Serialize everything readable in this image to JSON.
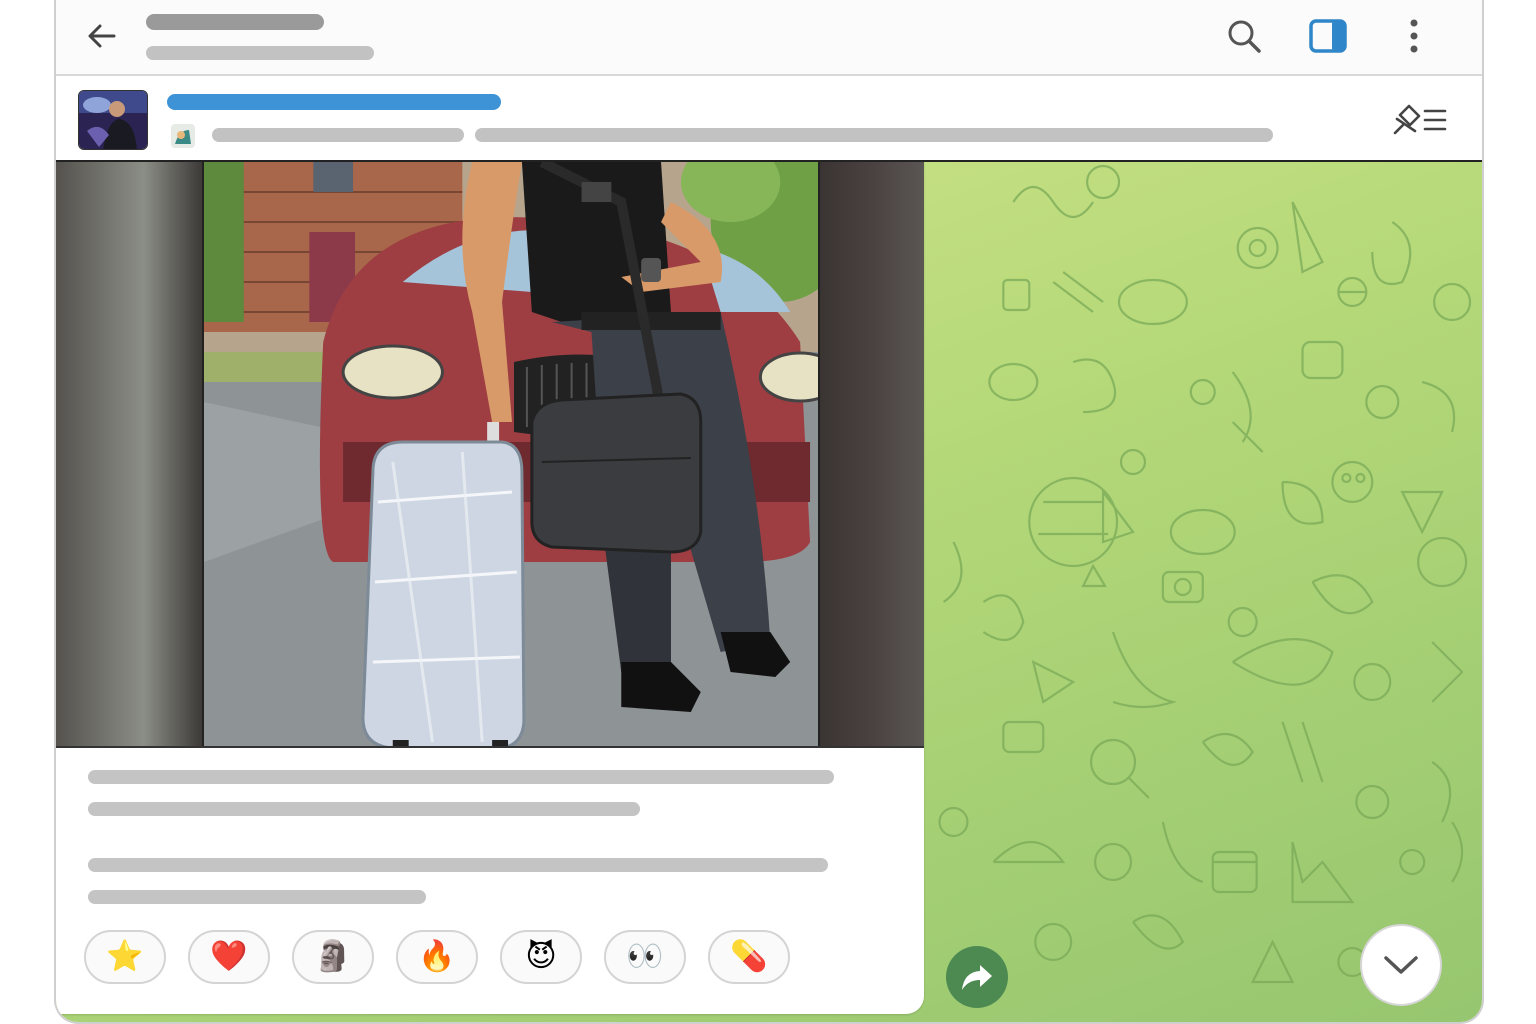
{
  "header": {
    "back_icon": "arrow-left-icon",
    "actions": [
      {
        "name": "search",
        "icon": "search-icon"
      },
      {
        "name": "sidebar-toggle",
        "icon": "sidebar-panel-icon",
        "accent": "#2f86c9"
      },
      {
        "name": "more-menu",
        "icon": "kebab-menu-icon"
      }
    ]
  },
  "pinned": {
    "title_color": "#3d93d6",
    "list_icon": "pin-list-icon"
  },
  "message": {
    "reactions": [
      {
        "emoji": "⭐",
        "icon": "star-reaction"
      },
      {
        "emoji": "❤️",
        "icon": "heart-reaction"
      },
      {
        "emoji": "🗿",
        "icon": "moai-reaction"
      },
      {
        "emoji": "🔥",
        "icon": "fire-reaction"
      },
      {
        "emoji": "😈",
        "icon": "devil-reaction"
      },
      {
        "emoji": "👀",
        "icon": "eyes-reaction"
      },
      {
        "emoji": "💊",
        "icon": "pill-reaction"
      }
    ]
  },
  "chat": {
    "background_color": "#b4d878",
    "share_icon": "share-arrow-icon",
    "share_color": "#4d8a52",
    "scroll_icon": "chevron-down-icon"
  }
}
